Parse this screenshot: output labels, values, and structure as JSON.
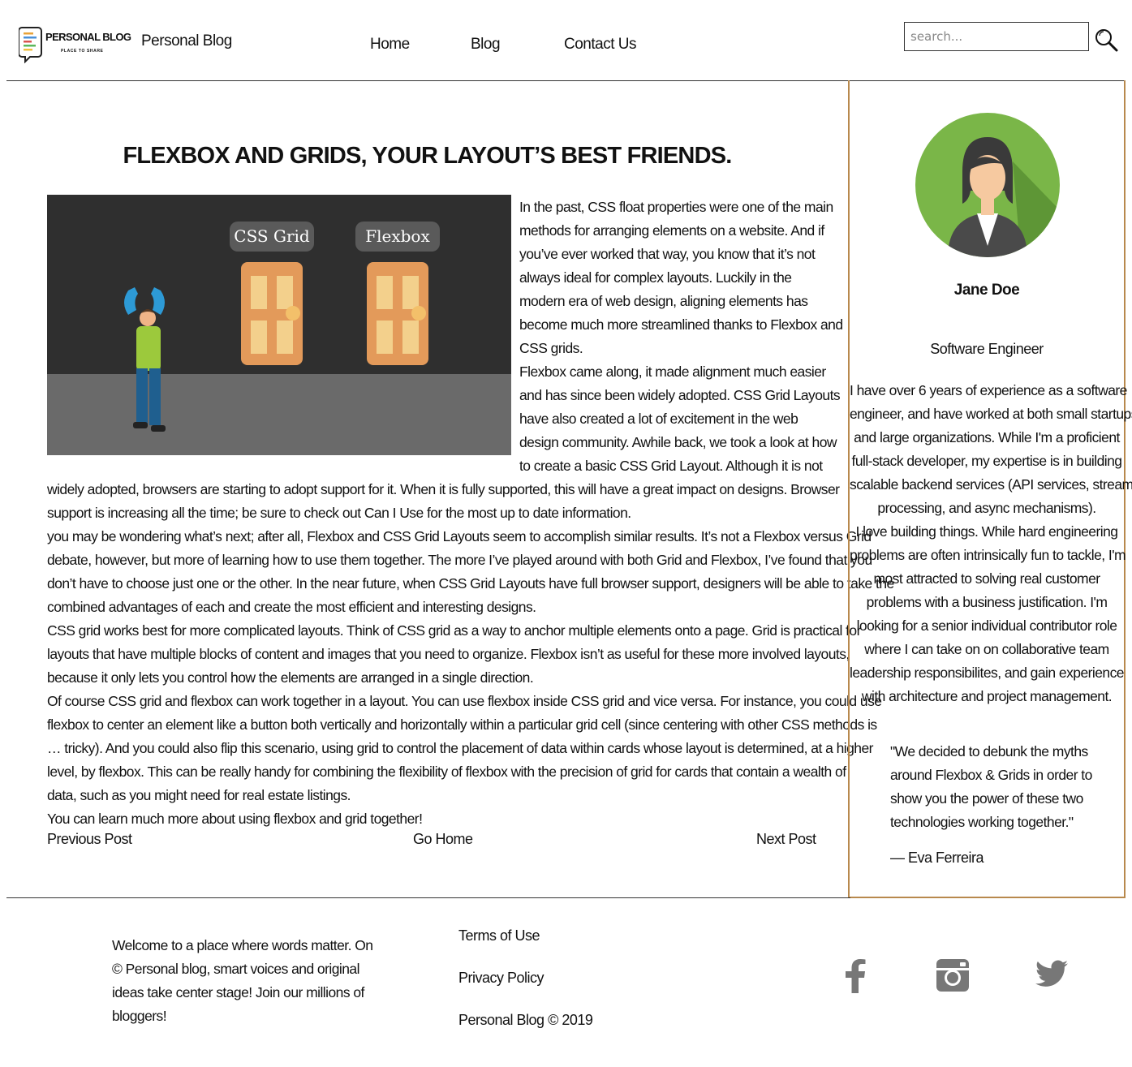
{
  "header": {
    "logo_title": "PERSONAL BLOG",
    "logo_tagline": "PLACE TO SHARE",
    "site_name": "Personal Blog",
    "nav": [
      {
        "label": "Home"
      },
      {
        "label": "Blog"
      },
      {
        "label": "Contact Us"
      }
    ],
    "search_placeholder": "search...",
    "search_icon": "search-icon"
  },
  "article": {
    "title": "FLEXBOX AND GRIDS, YOUR LAYOUT’S BEST FRIENDS.",
    "image": {
      "label_left": "CSS Grid",
      "label_right": "Flexbox"
    },
    "side_lines": [
      "In the past, CSS float properties were one of the main",
      "methods for arranging elements on a website. And if",
      "you’ve ever worked that way, you know that it’s not",
      "always ideal for complex layouts. Luckily in the",
      "modern era of web design, aligning elements has",
      "become much more streamlined thanks to Flexbox and",
      "CSS grids.",
      "Flexbox came along, it made alignment much easier",
      "and has since been widely adopted. CSS Grid Layouts",
      "have also created a lot of excitement in the web",
      "design community. Awhile back, we took a look at how",
      "to create a basic CSS Grid Layout. Although it is not"
    ],
    "full_lines": [
      "widely adopted, browsers are starting to adopt support for it. When it is fully supported, this will have a great impact on designs. Browser",
      "support is increasing all the time; be sure to check out Can I Use for the most up to date information.",
      "you may be wondering what’s next; after all, Flexbox and CSS Grid Layouts seem to accomplish similar results. It’s not a Flexbox versus Grid",
      "debate, however, but more of learning how to use them together. The more I’ve played around with both Grid and Flexbox, I’ve found that you",
      "don’t have to choose just one or the other. In the near future, when CSS Grid Layouts have full browser support, designers will be able to take the",
      "combined advantages of each and create the most efficient and interesting designs.",
      "CSS grid works best for more complicated layouts. Think of CSS grid as a way to anchor multiple elements onto a page. Grid is practical for",
      "layouts that have multiple blocks of content and images that you need to organize. Flexbox isn’t as useful for these more involved layouts,",
      "because it only lets you control how the elements are arranged in a single direction.",
      "Of course CSS grid and flexbox can work together in a layout. You can use flexbox inside CSS grid and vice versa. For instance, you could use",
      "flexbox to center an element like a button both vertically and horizontally within a particular grid cell (since centering with other CSS methods is",
      "… tricky). And you could also flip this scenario, using grid to control the placement of data within cards whose layout is determined, at a higher",
      "level, by flexbox. This can be really handy for combining the flexibility of flexbox with the precision of grid for cards that contain a wealth of",
      "data, such as you might need for real estate listings.",
      "You can learn much more about using flexbox and grid together!"
    ],
    "post_nav": {
      "previous": "Previous Post",
      "home": "Go Home",
      "next": "Next Post"
    }
  },
  "sidebar": {
    "author_name": "Jane Doe",
    "author_role": "Software Engineer",
    "bio_1": [
      "I have over 6 years of experience as a software",
      "engineer, and have worked at both small startups",
      "and large organizations. While I'm a proficient",
      "full-stack developer, my expertise is in building",
      "scalable backend services (API services, stream",
      "processing, and async mechanisms)."
    ],
    "bio_2": [
      "I love building things. While hard engineering",
      "problems are often intrinsically fun to tackle, I'm",
      "most attracted to solving real customer",
      "problems with a business justification. I'm",
      "looking for a senior individual contributor role",
      "where I can take on on collaborative team",
      "leadership responsibilites, and gain experience",
      "with architecture and project management."
    ],
    "quote": [
      "\"We decided to debunk the myths",
      "around Flexbox & Grids in order to",
      "show you the power of these two",
      "technologies working together.\""
    ],
    "quote_author": "— Eva Ferreira",
    "avatar_icon": "avatar-icon"
  },
  "footer": {
    "blurb": [
      "Welcome to a place where words matter. On",
      "© Personal blog, smart voices and original",
      "ideas take center stage! Join our millions of",
      "bloggers!"
    ],
    "links": [
      {
        "label": "Terms of Use"
      },
      {
        "label": "Privacy Policy"
      },
      {
        "label": "Personal Blog © 2019"
      }
    ],
    "social": [
      "facebook-icon",
      "instagram-icon",
      "twitter-icon"
    ]
  },
  "colors": {
    "sidebar_border": "#b8894d",
    "icon_gray": "#777777",
    "avatar_green": "#7ab648"
  }
}
